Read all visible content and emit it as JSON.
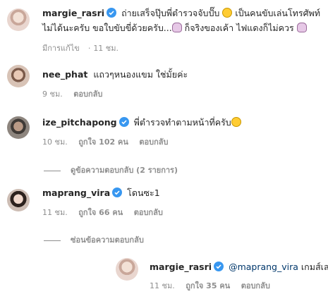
{
  "caption": {
    "username": "margie_rasri",
    "line1_text": "ถ่ายเสร็จปุ๊บพี่ตำรวจจับปั๊บ",
    "line1_text2": "เป็นคนขับเล่นโทรศัพท์",
    "line2_text": "ไม่ได้นะครับ ขอใบขับขี่ด้วยครับ...",
    "line2_text2": "ก็จริงของเค้า ไฟแดงก็ไม่ควร",
    "edited": "มีการแก้ไข",
    "time": "11 ชม."
  },
  "comments": [
    {
      "username": "nee_phat",
      "text": "แถวๆหนองแขม ใช่มั้ยค่ะ",
      "time": "9 ชม.",
      "reply_label": "ตอบกลับ"
    },
    {
      "username": "ize_pitchapong",
      "text": "พี่ตำรวจทำตามหน้าที่ครับ",
      "time": "10 ชม.",
      "likes": "ถูกใจ 102 คน",
      "reply_label": "ตอบกลับ",
      "view_replies": "ดูข้อความตอบกลับ (2 รายการ)"
    },
    {
      "username": "maprang_vira",
      "text": "โดนซะ1",
      "time": "11 ชม.",
      "likes": "ถูกใจ 66 คน",
      "reply_label": "ตอบกลับ",
      "hide_replies": "ซ่อนข้อความตอบกลับ"
    }
  ],
  "reply": {
    "username": "margie_rasri",
    "mention": "@maprang_vira",
    "text": "เกมส์เลยจ้า",
    "time": "11 ชม.",
    "likes": "ถูกใจ 35 คน",
    "reply_label": "ตอบกลับ"
  },
  "colors": {
    "verified": "#3897f0",
    "muted": "#8e8e8e",
    "mention": "#00376b"
  }
}
